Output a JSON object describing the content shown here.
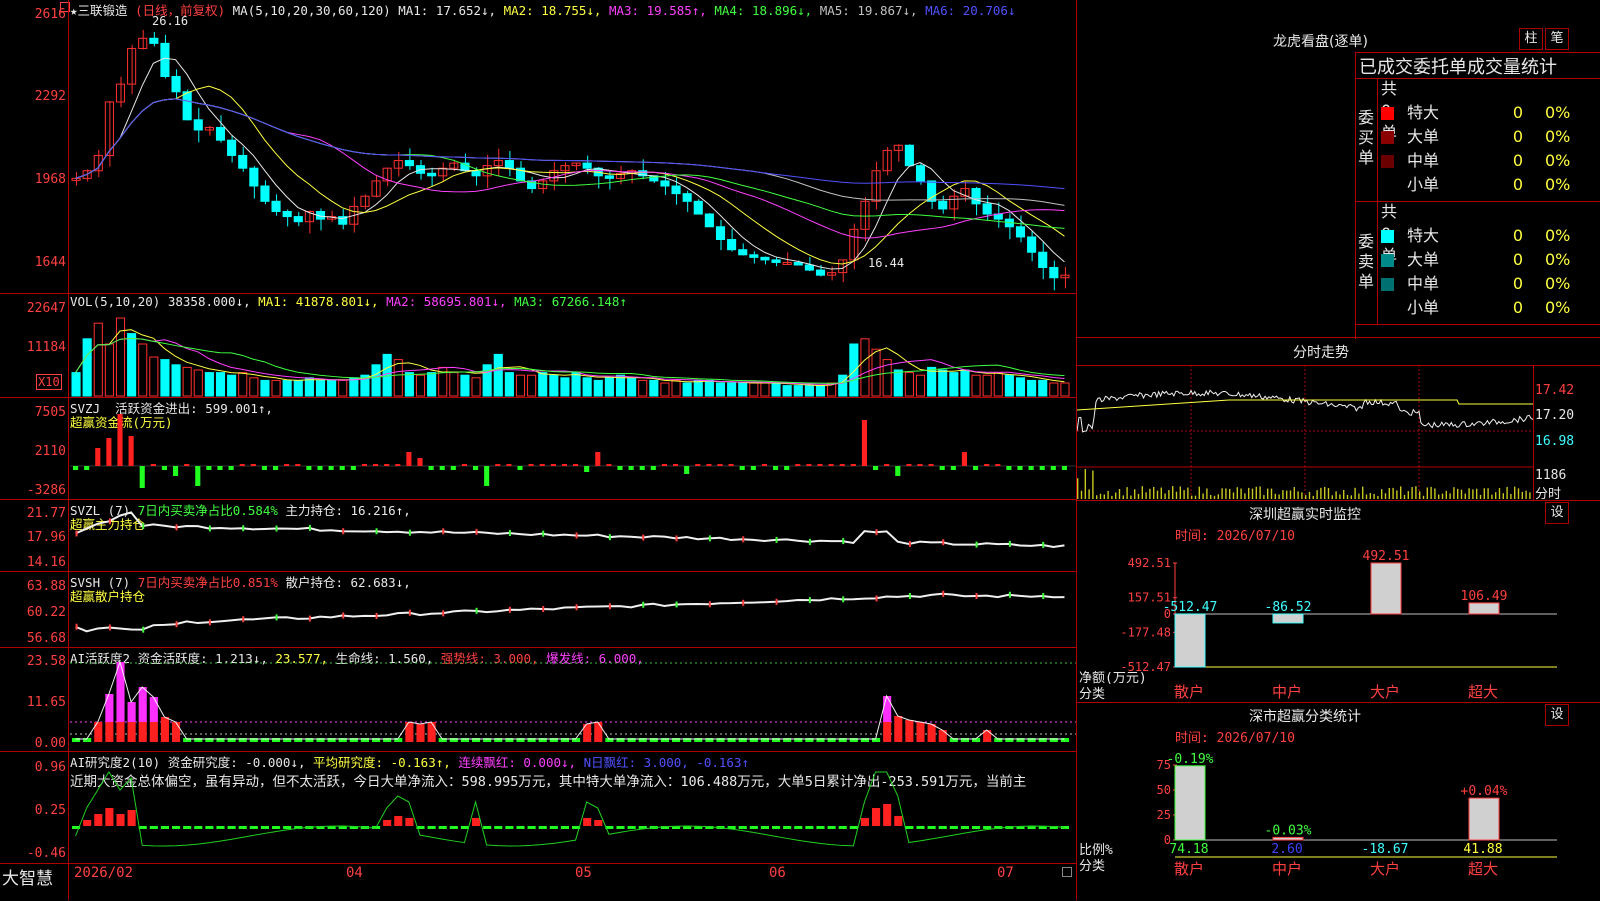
{
  "stock": {
    "name": "★三联锻造",
    "period": "(日线，前复权)",
    "ma_params": "MA(5,10,20,30,60,120)",
    "ma": [
      {
        "label": "MA1: 17.652↓,",
        "color": "#e8e8e8"
      },
      {
        "label": "MA2: 18.755↓,",
        "color": "#ffff40"
      },
      {
        "label": "MA3: 19.585↑,",
        "color": "#ff40ff"
      },
      {
        "label": "MA4: 18.896↓,",
        "color": "#40ff40"
      },
      {
        "label": "MA5: 19.867↓,",
        "color": "#c0c0c0"
      },
      {
        "label": "MA6: 20.706↓",
        "color": "#5050ff"
      }
    ],
    "y_labels": [
      "2616",
      "2292",
      "1968",
      "1644"
    ],
    "high_mark": "26.16",
    "low_mark": "16.44"
  },
  "vol": {
    "legend": "VOL(5,10,20)",
    "value": "38358.000↓,",
    "ma": [
      {
        "label": "MA1: 41878.801↓,",
        "color": "#ffff40"
      },
      {
        "label": "MA2: 58695.801↓,",
        "color": "#ff40ff"
      },
      {
        "label": "MA3: 67266.148↑",
        "color": "#40ff40"
      }
    ],
    "y_labels": [
      "22647",
      "11184"
    ],
    "unit": "X10"
  },
  "svzj": {
    "legend": "SVZJ",
    "text": "活跃资金进出: 599.001↑,",
    "sub": "超赢资金流(万元)",
    "y_labels": [
      "7505",
      "2110",
      "-3286"
    ]
  },
  "svzl": {
    "legend": "SVZL (7)",
    "text1": "7日内买卖净占比0.584%",
    "text2": "主力持仓: 16.216↑,",
    "sub": "超赢主力持仓",
    "y_labels": [
      "21.77",
      "17.96",
      "14.16"
    ]
  },
  "svsh": {
    "legend": "SVSH (7)",
    "text1": "7日内买卖净占比0.851%",
    "text2": "散户持仓: 62.683↓,",
    "sub": "超赢散户持仓",
    "y_labels": [
      "63.88",
      "60.22",
      "56.68"
    ]
  },
  "ai1": {
    "legend": "AI活跃度2",
    "t1": "资金活跃度: 1.213↓,",
    "t2": "23.577,",
    "t3": "生命线: 1.560,",
    "t4": "强势线: 3.000,",
    "t5": "爆发线: 6.000,",
    "y_labels": [
      "23.58",
      "11.65",
      "0.00"
    ]
  },
  "ai2": {
    "legend": "AI研究度2(10)",
    "t1": "资金研究度: -0.000↓,",
    "t2": "平均研究度: -0.163↑,",
    "t3": "连续飘红: 0.000↓,",
    "t4": "N日飘红: 3.000, -0.163↑",
    "comment": "近期大资金总体偏空，虽有异动，但不太活跃，今日大单净流入：598.995万元，其中特大单净流入：106.488万元，大单5日累计净出-253.591万元，当前主",
    "y_labels": [
      "0.96",
      "0.25",
      "-0.46"
    ]
  },
  "xaxis": {
    "brand": "大智慧",
    "dates": [
      "2026/02",
      "04",
      "05",
      "06",
      "07"
    ]
  },
  "dragon": {
    "title": "龙虎看盘(逐单)",
    "btn1": "柱",
    "btn2": "笔",
    "subtitle": "已成交委托单成交量统计",
    "buy": {
      "side": "委买单",
      "total": "共 0单",
      "rows": [
        {
          "label": "特大",
          "value": "0",
          "pct": "0%",
          "color": "#ff0000"
        },
        {
          "label": "大单",
          "value": "0",
          "pct": "0%",
          "color": "#8b0000"
        },
        {
          "label": "中单",
          "value": "0",
          "pct": "0%",
          "color": "#6b0000"
        },
        {
          "label": "小单",
          "value": "0",
          "pct": "0%",
          "color": ""
        }
      ]
    },
    "sell": {
      "side": "委卖单",
      "total": "共 0单",
      "rows": [
        {
          "label": "特大",
          "value": "0",
          "pct": "0%",
          "color": "#00ffff"
        },
        {
          "label": "大单",
          "value": "0",
          "pct": "0%",
          "color": "#008b8b"
        },
        {
          "label": "中单",
          "value": "0",
          "pct": "0%",
          "color": "#007070"
        },
        {
          "label": "小单",
          "value": "0",
          "pct": "0%",
          "color": ""
        }
      ]
    }
  },
  "intraday": {
    "title": "分时走势",
    "prices": [
      "17.42",
      "17.20",
      "16.98"
    ],
    "vol": "1186",
    "label": "分时"
  },
  "monitor": {
    "title": "深圳超赢实时监控",
    "btn": "设",
    "time": "时间: 2026/07/10",
    "y_labels": [
      "492.51",
      "157.51",
      "0",
      "-177.48",
      "-512.47"
    ],
    "axis_label1": "净额(万元)",
    "axis_label2": "分类",
    "bars": [
      {
        "cat": "散户",
        "value": -512.47,
        "text": "-512.47"
      },
      {
        "cat": "中户",
        "value": -86.52,
        "text": "-86.52"
      },
      {
        "cat": "大户",
        "value": 492.51,
        "text": "492.51"
      },
      {
        "cat": "超大",
        "value": 106.49,
        "text": "106.49"
      }
    ]
  },
  "classify": {
    "title": "深市超赢分类统计",
    "btn": "设",
    "time": "时间: 2026/07/10",
    "y_labels": [
      "75",
      "50",
      "25",
      "0"
    ],
    "axis_label1": "比例%",
    "axis_label2": "分类",
    "bars": [
      {
        "cat": "散户",
        "value": 74.18,
        "text": "74.18",
        "delta": "-0.19%"
      },
      {
        "cat": "中户",
        "value": 2.6,
        "text": "2.60",
        "delta": "-0.03%"
      },
      {
        "cat": "大户",
        "value": -18.67,
        "text": "-18.67",
        "delta": ""
      },
      {
        "cat": "超大",
        "value": 41.88,
        "text": "41.88",
        "delta": "+0.04%"
      }
    ]
  }
}
